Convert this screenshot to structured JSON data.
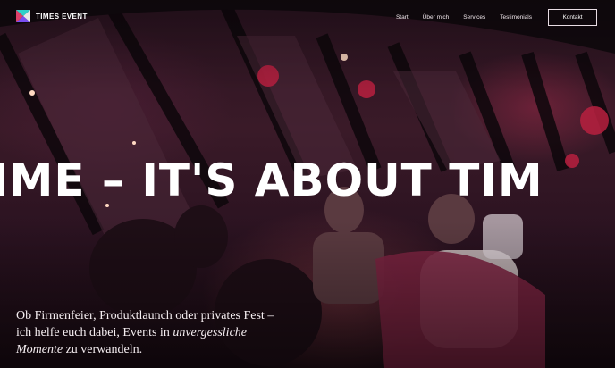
{
  "brand": {
    "name": "TIMES EVENT",
    "logo_icon": "hourglass-x-logo",
    "accent_colors": [
      "#2fd0c9",
      "#7a4df0",
      "#ff4a7a"
    ]
  },
  "nav": {
    "items": [
      {
        "label": "Start"
      },
      {
        "label": "Über mich"
      },
      {
        "label": "Services"
      },
      {
        "label": "Testimonials"
      }
    ],
    "cta_label": "Kontakt"
  },
  "hero": {
    "headline": "IME – IT'S ABOUT TIM",
    "tagline_prefix": "Ob Firmenfeier, Produktlaunch oder privates Fest – ich helfe euch dabei, Events in ",
    "tagline_emphasis": "unvergessliche Momente",
    "tagline_suffix": " zu verwandeln."
  }
}
